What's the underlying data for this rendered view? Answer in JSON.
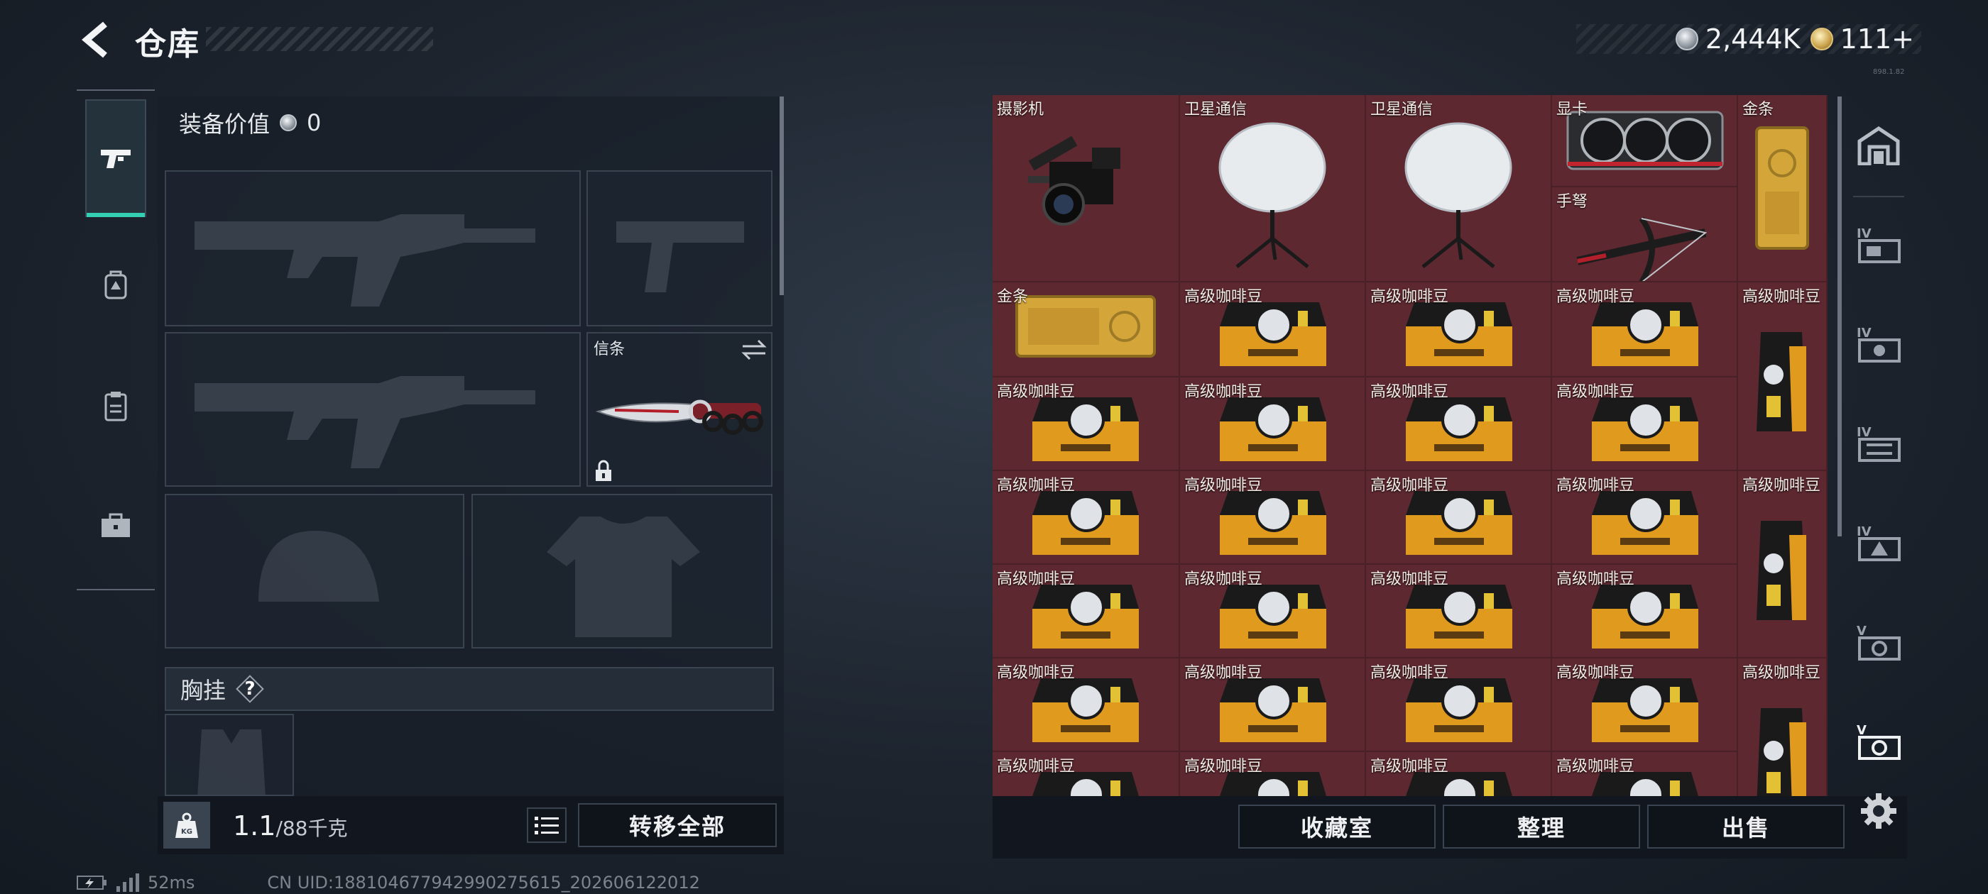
{
  "header": {
    "title": "仓库",
    "currencies": [
      {
        "icon": "silver-coin-icon",
        "value": "2,444K"
      },
      {
        "icon": "gold-coin-icon",
        "value": "111+"
      }
    ],
    "version": "898.1.82"
  },
  "left_tabs": [
    {
      "icon": "pistol-icon",
      "active": true
    },
    {
      "icon": "backpack-icon",
      "active": false
    },
    {
      "icon": "clipboard-icon",
      "active": false
    },
    {
      "icon": "toolbox-icon",
      "active": false
    }
  ],
  "equipment": {
    "value_label": "装备价值",
    "value": "0",
    "melee_label": "信条",
    "chest_label": "胸挂",
    "chest_help": "?"
  },
  "weight": {
    "icon_text": "KG",
    "current": "1.1",
    "capacity": "/88千克"
  },
  "buttons": {
    "transfer_all": "转移全部",
    "collection": "收藏室",
    "organize": "整理",
    "sell": "出售"
  },
  "status_bar": {
    "ping": "52ms",
    "uid": "CN UID:188104677942990275615_202606122012"
  },
  "storage_items": [
    {
      "name": "摄影机",
      "kind": "camera"
    },
    {
      "name": "卫星通信",
      "kind": "dish"
    },
    {
      "name": "卫星通信",
      "kind": "dish"
    },
    {
      "name": "显卡",
      "kind": "gpu"
    },
    {
      "name": "手弩",
      "kind": "crossbow"
    },
    {
      "name": "金条",
      "kind": "goldbar-tall"
    },
    {
      "name": "金条",
      "kind": "goldbar"
    },
    {
      "name": "高级咖啡豆",
      "kind": "coffee"
    },
    {
      "name": "高级咖啡豆",
      "kind": "coffee-tall"
    }
  ],
  "colors": {
    "accent": "#35d0b3",
    "cell_bg": "#5d2830",
    "panel_bg": "#181f28"
  }
}
